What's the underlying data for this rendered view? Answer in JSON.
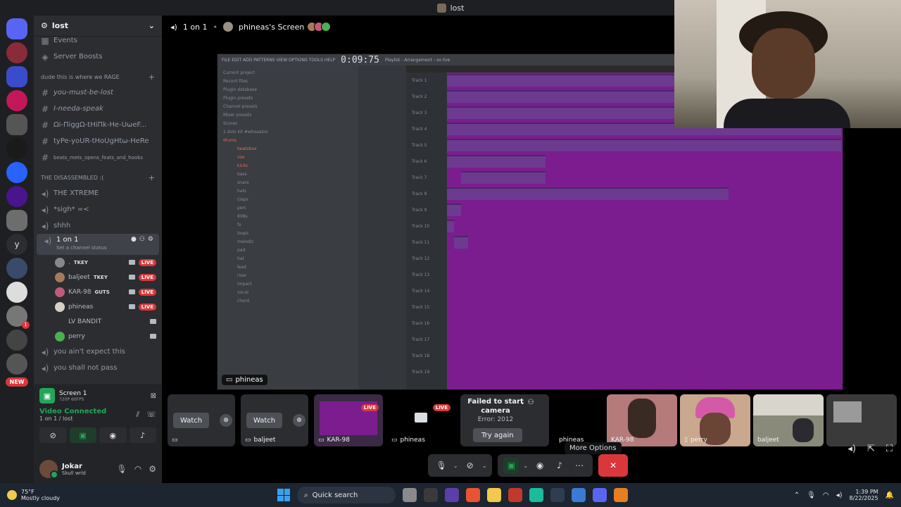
{
  "window": {
    "title": "lost"
  },
  "server": {
    "name": "lost",
    "items": [
      {
        "icon": "calendar-icon",
        "label": "Events"
      },
      {
        "icon": "boost-icon",
        "label": "Server Boosts"
      }
    ],
    "categories": [
      {
        "name": "dude this is where we RAGE",
        "channels": [
          {
            "label": "you-must-be-lost",
            "italic": true
          },
          {
            "label": "I-needa-speak",
            "italic": true
          },
          {
            "label": "Ωi-ΠiggΩ-tHiΠk-He-UωeF...",
            "italic": false
          },
          {
            "label": "tyPe-yoUR-tHoUgHtω-HeRe",
            "italic": false
          },
          {
            "label": "beats_mets_opens_feats_and_hooks",
            "italic": false,
            "tiny": true
          }
        ]
      },
      {
        "name": "THE DISASSEMBLED :(",
        "channels": [
          {
            "label": "THE XTREME"
          },
          {
            "label": "*sigh* =<"
          },
          {
            "label": "shhh"
          }
        ]
      }
    ],
    "active_voice": {
      "label": "1 on 1",
      "status": "Set a channel status",
      "users": [
        {
          "name": ".",
          "tag": "TKEY",
          "live": true,
          "cam": true
        },
        {
          "name": "baljeet",
          "tag": "TKEY",
          "live": true,
          "cam": true
        },
        {
          "name": "KAR-98",
          "tag": "GUTS",
          "live": true,
          "cam": true
        },
        {
          "name": "phineas",
          "tag": "",
          "live": true,
          "cam": true
        },
        {
          "name": "LV BANDIT",
          "tag": "",
          "live": false,
          "cam": true
        },
        {
          "name": "perry",
          "tag": "",
          "live": false,
          "cam": true
        }
      ]
    },
    "after_channels": [
      {
        "label": "you ain't expect this"
      },
      {
        "label": "you shall not pass"
      }
    ],
    "live_label": "LIVE",
    "new_label": "NEW",
    "rail_y": "y",
    "rail_badge": "1"
  },
  "voice_panel": {
    "screen_title": "Screen 1",
    "screen_sub": "720P 60FPS",
    "connected": "Video Connected",
    "channel_path": "1 on 1 / lost"
  },
  "user": {
    "name": "Jokar",
    "status": "Skull wrld"
  },
  "stage": {
    "channel": "1 on 1",
    "screen_owner": "phineas's Screen",
    "shared_label": "phineas",
    "fl_time": "0:09:75",
    "fl_menu": "FILE EDIT ADD PATTERNS VIEW OPTIONS TOOLS HELP",
    "fl_playlist": "Playlist - Arrangement › so live",
    "fl_browser": [
      "Current project",
      "Recent files",
      "Plugin database",
      "Plugin presets",
      "Channel presets",
      "Mixer presets",
      "Scores",
      "1 dolo kit #whoaaloo",
      "drums",
      "beatsbox",
      "vox",
      "kicks",
      "bass",
      "snare",
      "hats",
      "claps",
      "perc",
      "808s",
      "fx",
      "loops",
      "melodic",
      "pad",
      "hat",
      "lead",
      "riser",
      "impact",
      "vocal",
      "chord"
    ],
    "fl_tracks": [
      "Track 1",
      "Track 2",
      "Track 3",
      "Track 4",
      "Track 5",
      "Track 6",
      "Track 7",
      "Track 8",
      "Track 9",
      "Track 10",
      "Track 11",
      "Track 12",
      "Track 13",
      "Track 14",
      "Track 15",
      "Track 16",
      "Track 17",
      "Track 18",
      "Track 19"
    ]
  },
  "strip": {
    "watch_label": "Watch",
    "tiles": [
      {
        "name": "",
        "watch": true
      },
      {
        "name": "baljeet",
        "watch": true
      },
      {
        "name": "KAR-98",
        "live": true
      },
      {
        "name": "phineas",
        "live": true
      },
      {
        "name": "phineas",
        "fail_title": "Failed to start camera",
        "fail_err": "Error: 2012",
        "retry": "Try again"
      },
      {
        "name": "KAR-98"
      },
      {
        "name": "perry"
      },
      {
        "name": "baljeet"
      },
      {
        "name": ""
      }
    ]
  },
  "tooltip": "More Options",
  "taskbar": {
    "temp": "75°F",
    "weather": "Mostly cloudy",
    "search": "Quick search",
    "time": "1:39 PM",
    "date": "8/22/2025"
  },
  "colors": {
    "accent": "#23a559",
    "danger": "#da373c",
    "playlist": "#7b1d8f"
  }
}
